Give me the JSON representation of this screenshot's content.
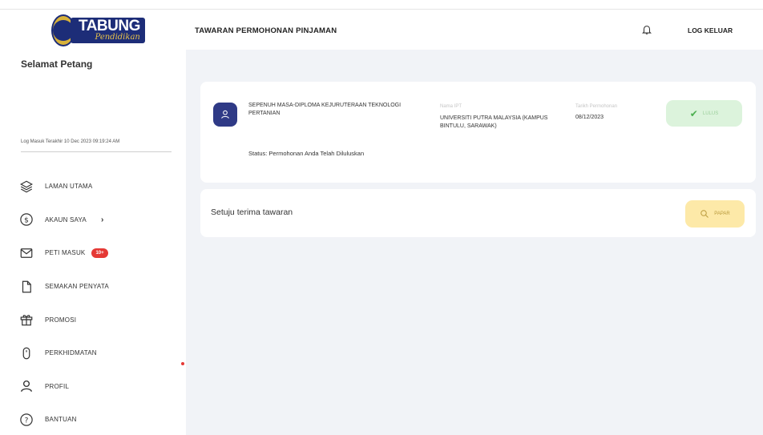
{
  "logo": {
    "word1": "TABUNG",
    "word2": "Pendidikan"
  },
  "sidebar": {
    "greeting": "Selamat Petang",
    "last_login": "Log Masuk Terakhir 10 Dec 2023 09:19:24 AM",
    "items": [
      {
        "label": "LAMAN UTAMA",
        "icon": "layers-icon"
      },
      {
        "label": "AKAUN SAYA",
        "icon": "dollar-circle-icon",
        "chevron": "›"
      },
      {
        "label": "PETI MASUK",
        "icon": "mail-icon",
        "badge": "10+"
      },
      {
        "label": "SEMAKAN PENYATA",
        "icon": "document-icon"
      },
      {
        "label": "PROMOSI",
        "icon": "gift-icon"
      },
      {
        "label": "PERKHIDMATAN",
        "icon": "mouse-icon"
      },
      {
        "label": "PROFIL",
        "icon": "user-icon"
      },
      {
        "label": "BANTUAN",
        "icon": "help-circle-icon"
      }
    ]
  },
  "header": {
    "title": "TAWARAN PERMOHONAN PINJAMAN",
    "logout": "LOG KELUAR"
  },
  "offer": {
    "course": "SEPENUH MASA-DIPLOMA KEJURUTERAAN TEKNOLOGI PERTANIAN",
    "ipt_label": "Nama IPT",
    "ipt_value": "UNIVERSITI PUTRA MALAYSIA (KAMPUS BINTULU, SARAWAK)",
    "date_label": "Tarikh Permohonan",
    "date_value": "08/12/2023",
    "status_button": "LULUS",
    "status_text": "Status: Permohonan Anda Telah Diluluskan"
  },
  "accept": {
    "text": "Setuju terima tawaran",
    "button": "PAPAR"
  },
  "colors": {
    "brand_navy": "#1d2d78",
    "brand_gold": "#d8b23a",
    "avatar": "#2f3a86",
    "success_bg": "#dcf3dc",
    "view_bg": "#fde9a8",
    "badge": "#e53935",
    "main_bg": "#f1f3f7"
  }
}
